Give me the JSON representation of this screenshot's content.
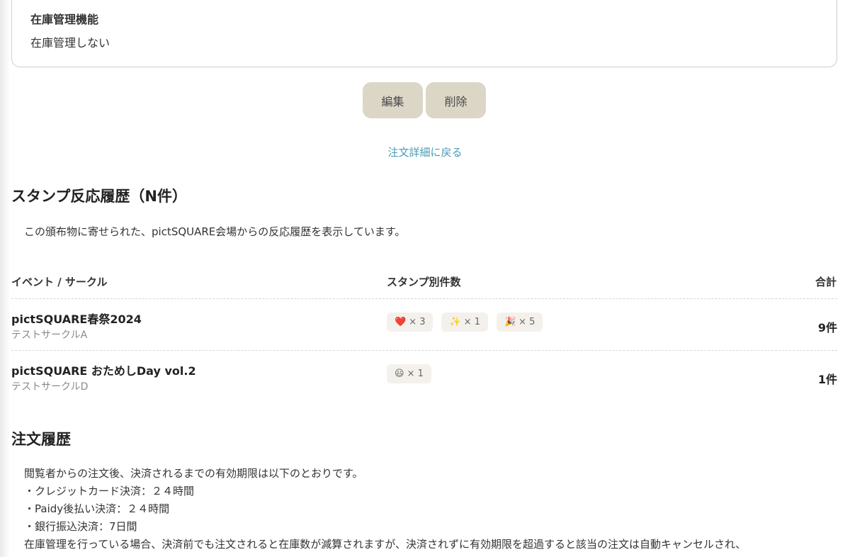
{
  "inventory": {
    "label": "在庫管理機能",
    "value": "在庫管理しない"
  },
  "actions": {
    "edit_label": "編集",
    "delete_label": "削除",
    "back_label": "注文詳細に戻る"
  },
  "stamp_history": {
    "title": "スタンプ反応履歴（N件）",
    "description": "この頒布物に寄せられた、pictSQUARE会場からの反応履歴を表示しています。",
    "columns": {
      "event": "イベント / サークル",
      "stamps": "スタンプ別件数",
      "total": "合計"
    },
    "rows": [
      {
        "event": "pictSQUARE春祭2024",
        "circle": "テストサークルA",
        "stamps": [
          {
            "icon": "heart-icon",
            "emoji": "❤️",
            "count": "× 3"
          },
          {
            "icon": "sparkles-icon",
            "emoji": "✨",
            "count": "× 1"
          },
          {
            "icon": "party-popper-icon",
            "emoji": "🎉",
            "count": "× 5"
          }
        ],
        "total": "9件"
      },
      {
        "event": "pictSQUARE おためしDay vol.2",
        "circle": "テストサークルD",
        "stamps": [
          {
            "icon": "smiley-icon",
            "emoji": "😃",
            "count": "× 1"
          }
        ],
        "total": "1件"
      }
    ]
  },
  "order_history": {
    "title": "注文履歴",
    "notes": [
      "閲覧者からの注文後、決済されるまでの有効期限は以下のとおりです。",
      "・クレジットカード決済：２４時間",
      "・Paidy後払い決済：２４時間",
      "・銀行振込決済：7日間",
      "在庫管理を行っている場合、決済前でも注文されると在庫数が減算されますが、決済されずに有効期限を超過すると該当の注文は自動キャンセルされ、"
    ]
  },
  "colors": {
    "button_bg": "#dcd6c7",
    "link": "#4a9bb3",
    "chip_bg": "#f4f1ec"
  }
}
